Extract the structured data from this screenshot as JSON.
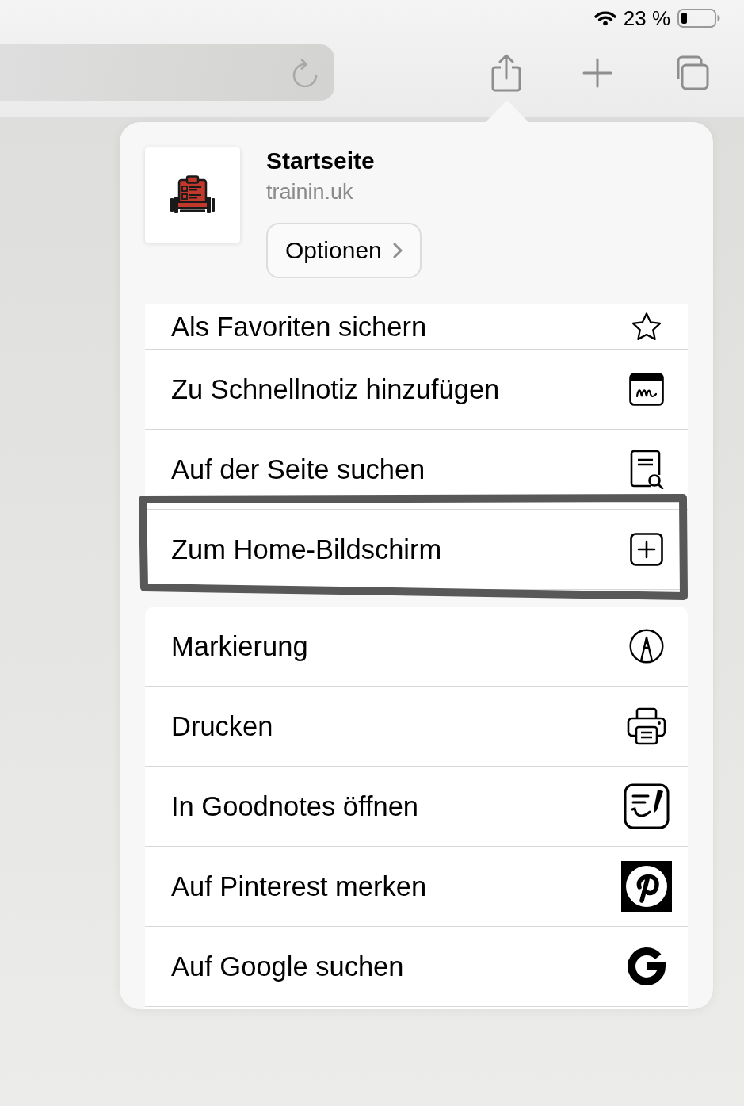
{
  "status_bar": {
    "battery_percent": "23 %"
  },
  "share_sheet": {
    "page_title": "Startseite",
    "page_url": "trainin.uk",
    "options_button": "Optionen",
    "groups": [
      {
        "items": [
          {
            "label": "Als Favoriten sichern",
            "circled": false
          },
          {
            "label": "Zu Schnellnotiz hinzufügen",
            "circled": false
          },
          {
            "label": "Auf der Seite suchen",
            "circled": false
          },
          {
            "label": "Zum Home-Bildschirm",
            "circled": true
          }
        ]
      },
      {
        "items": [
          {
            "label": "Markierung",
            "circled": false
          },
          {
            "label": "Drucken",
            "circled": false
          },
          {
            "label": "In Goodnotes öffnen",
            "circled": false
          },
          {
            "label": "Auf Pinterest merken",
            "circled": false
          },
          {
            "label": "Auf Google suchen",
            "circled": false
          }
        ]
      }
    ]
  }
}
